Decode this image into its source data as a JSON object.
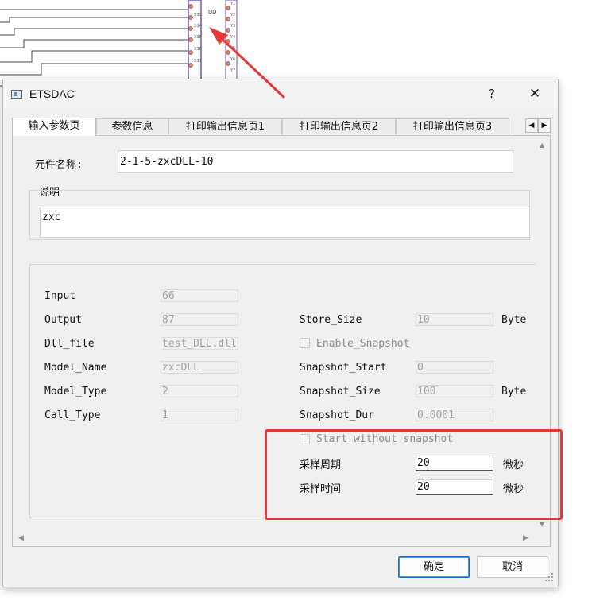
{
  "schematic": {
    "label": "UD",
    "left_pins": [
      "X33",
      "X34",
      "X35",
      "X36",
      "X37"
    ],
    "right_pins": [
      "Y1",
      "Y2",
      "Y3",
      "Y4",
      "Y5",
      "Y6",
      "Y7"
    ]
  },
  "dialog": {
    "title": "ETSDAC",
    "help_label": "?",
    "close_label": "✕"
  },
  "tabs": [
    {
      "label": "输入参数页",
      "active": true
    },
    {
      "label": "参数信息",
      "active": false
    },
    {
      "label": "打印输出信息页1",
      "active": false
    },
    {
      "label": "打印输出信息页2",
      "active": false
    },
    {
      "label": "打印输出信息页3",
      "active": false
    }
  ],
  "tab_scroll": {
    "left": "◀",
    "right": "▶"
  },
  "form": {
    "component_name_label": "元件名称:",
    "component_name_value": "2-1-5-zxcDLL-10",
    "description_label": "说明",
    "description_value": "zxc",
    "params_left": [
      {
        "label": "Input",
        "value": "66"
      },
      {
        "label": "Output",
        "value": "87"
      },
      {
        "label": "Dll_file",
        "value": "test_DLL.dll"
      },
      {
        "label": "Model_Name",
        "value": "zxcDLL"
      },
      {
        "label": "Model_Type",
        "value": "2"
      },
      {
        "label": "Call_Type",
        "value": "1"
      }
    ],
    "store_size": {
      "label": "Store_Size",
      "value": "10",
      "unit": "Byte"
    },
    "enable_snapshot": {
      "label": "Enable_Snapshot",
      "checked": false
    },
    "snapshot_start": {
      "label": "Snapshot_Start",
      "value": "0"
    },
    "snapshot_size": {
      "label": "Snapshot_Size",
      "value": "100",
      "unit": "Byte"
    },
    "snapshot_dur": {
      "label": "Snapshot_Dur",
      "value": "0.0001"
    },
    "start_without_snapshot": {
      "label": "Start without snapshot",
      "checked": false
    },
    "sample_period": {
      "label": "采样周期",
      "value": "20",
      "unit": "微秒"
    },
    "sample_time": {
      "label": "采样时间",
      "value": "20",
      "unit": "微秒"
    }
  },
  "buttons": {
    "ok": "确定",
    "cancel": "取消"
  },
  "annotation": {
    "color": "#e53935"
  }
}
